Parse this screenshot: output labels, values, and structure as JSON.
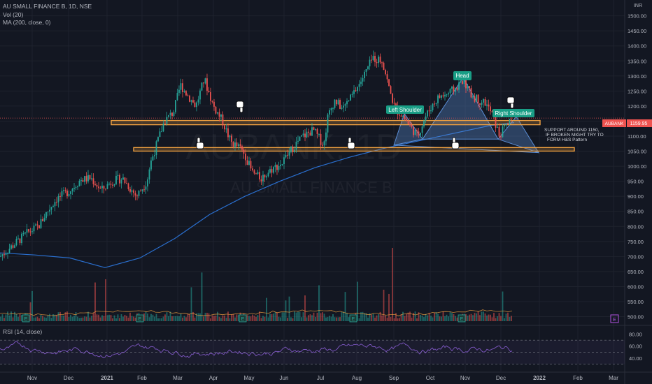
{
  "legend": {
    "title": "AU SMALL FINANCE B, 1D, NSE",
    "vol": "Vol (20)",
    "ma": "MA (200, close, 0)",
    "rsi": "RSI (14, close)"
  },
  "watermark": {
    "symbol": "AUBANK, 1D",
    "name": "AU SMALL FINANCE B"
  },
  "currency": "INR",
  "price_tag": {
    "symbol": "AUBANK",
    "value": "1159.95"
  },
  "annotations": {
    "head": "Head",
    "left_shoulder": "Left Shoulder",
    "right_shoulder": "Right Shoulder",
    "note_1": "SUPPORT AROUND 1150,",
    "note_2": "IF BROKEN MIGHT TRY TO",
    "note_3": "FORM H&S Pattern"
  },
  "event_badge": "E",
  "colors": {
    "background": "#131722",
    "up": "#26a69a",
    "down": "#ef5350",
    "ma": "#2a6fcf",
    "support_band": "#f0a040",
    "pattern": "#5b8ed6",
    "label": "#199e86",
    "rsi": "#7e57c2"
  },
  "chart_data": {
    "type": "candlestick",
    "y_ticks": [
      "1500.00",
      "1450.00",
      "1400.00",
      "1350.00",
      "1300.00",
      "1250.00",
      "1200.00",
      "1150.00",
      "1100.00",
      "1050.00",
      "1000.00",
      "950.00",
      "900.00",
      "850.00",
      "800.00",
      "750.00",
      "700.00",
      "650.00",
      "600.00",
      "550.00",
      "500.00"
    ],
    "x_ticks": [
      "Nov",
      "Dec",
      "2021",
      "Feb",
      "Mar",
      "Apr",
      "May",
      "Jun",
      "Jul",
      "Aug",
      "Sep",
      "Oct",
      "Nov",
      "Dec",
      "2022",
      "Feb",
      "Mar"
    ],
    "rsi_ticks": [
      "80.00",
      "60.00",
      "40.00"
    ],
    "ylim": [
      485,
      1520
    ],
    "price_path": [
      [
        0,
        700
      ],
      [
        20,
        740
      ],
      [
        40,
        780
      ],
      [
        55,
        800
      ],
      [
        65,
        840
      ],
      [
        80,
        890
      ],
      [
        100,
        920
      ],
      [
        115,
        955
      ],
      [
        130,
        960
      ],
      [
        145,
        920
      ],
      [
        160,
        950
      ],
      [
        175,
        960
      ],
      [
        195,
        900
      ],
      [
        210,
        950
      ],
      [
        215,
        1010
      ],
      [
        225,
        1080
      ],
      [
        235,
        1150
      ],
      [
        248,
        1180
      ],
      [
        258,
        1270
      ],
      [
        270,
        1230
      ],
      [
        280,
        1200
      ],
      [
        292,
        1290
      ],
      [
        305,
        1200
      ],
      [
        318,
        1150
      ],
      [
        330,
        1080
      ],
      [
        343,
        1060
      ],
      [
        350,
        1040
      ],
      [
        360,
        980
      ],
      [
        373,
        960
      ],
      [
        388,
        990
      ],
      [
        403,
        1010
      ],
      [
        418,
        1060
      ],
      [
        433,
        1100
      ],
      [
        448,
        1120
      ],
      [
        463,
        1070
      ],
      [
        468,
        1160
      ],
      [
        478,
        1220
      ],
      [
        490,
        1190
      ],
      [
        505,
        1240
      ],
      [
        520,
        1300
      ],
      [
        533,
        1360
      ],
      [
        547,
        1350
      ],
      [
        557,
        1250
      ],
      [
        565,
        1190
      ],
      [
        575,
        1170
      ],
      [
        587,
        1130
      ],
      [
        597,
        1100
      ],
      [
        607,
        1160
      ],
      [
        617,
        1200
      ],
      [
        627,
        1230
      ],
      [
        640,
        1240
      ],
      [
        652,
        1260
      ],
      [
        662,
        1290
      ],
      [
        672,
        1240
      ],
      [
        684,
        1220
      ],
      [
        694,
        1210
      ],
      [
        704,
        1170
      ],
      [
        714,
        1100
      ],
      [
        724,
        1140
      ],
      [
        733,
        1150
      ]
    ],
    "support_levels": [
      1145,
      1055
    ],
    "last_price": 1159.95,
    "rsi_range": [
      20,
      90
    ]
  }
}
